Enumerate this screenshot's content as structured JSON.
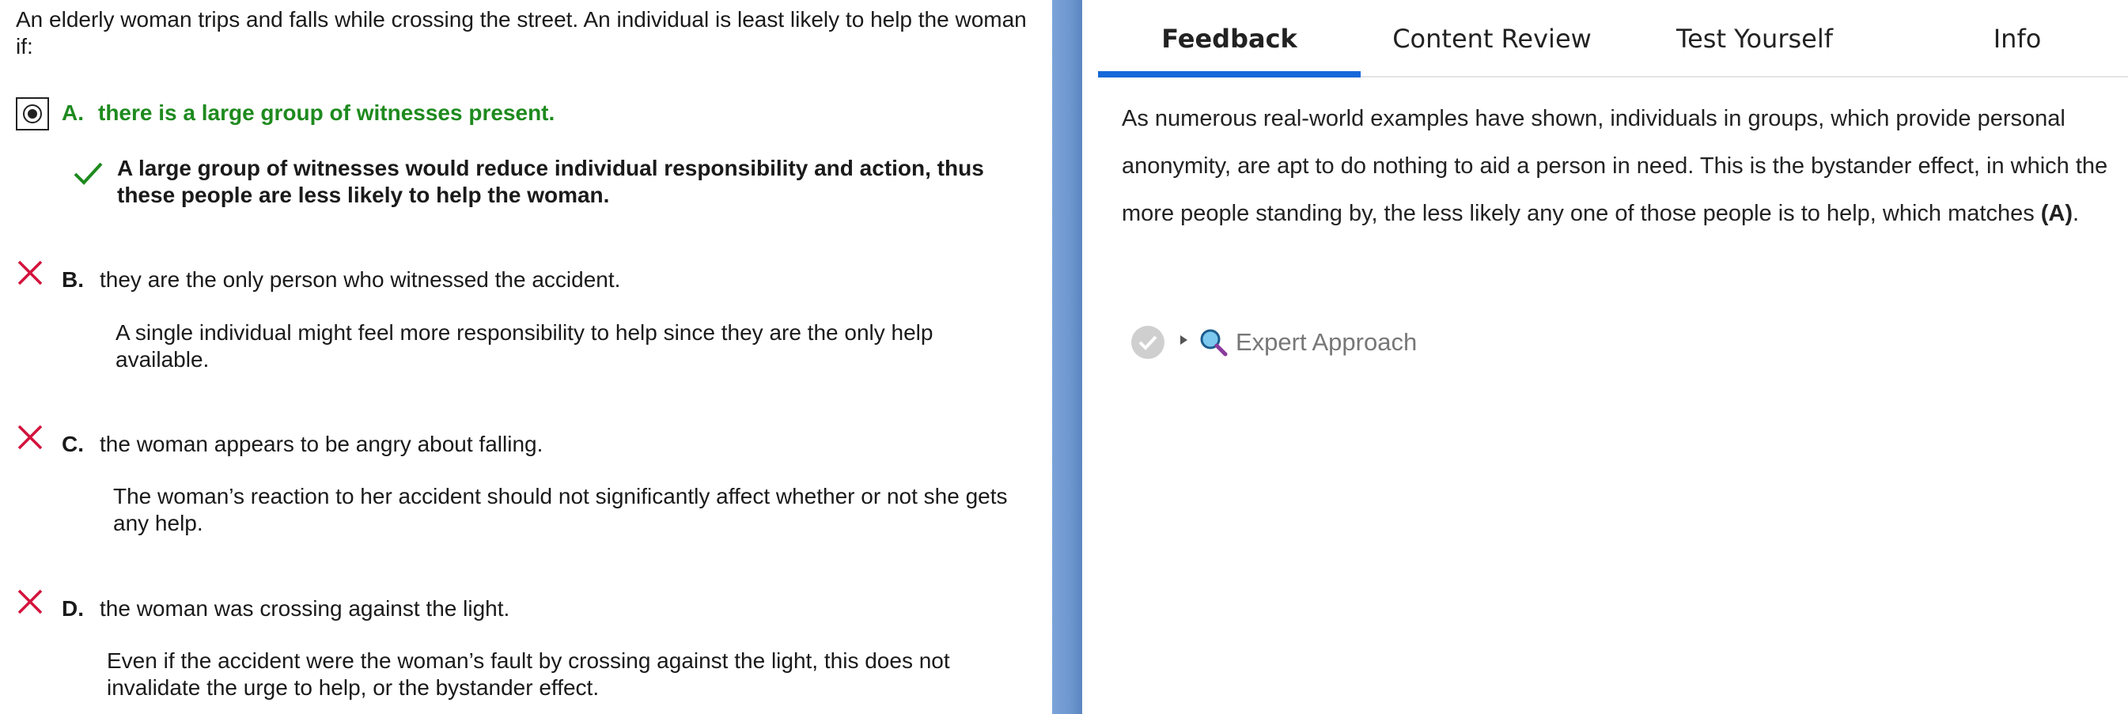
{
  "question": "An elderly woman trips and falls while crossing the street. An individual is least likely to help the woman if:",
  "options": [
    {
      "letter": "A.",
      "text": "there is a large group of witnesses present.",
      "explanation": "A large group of witnesses would reduce individual responsibility and action, thus these people are less likely to help the woman.",
      "status": "correct-selected"
    },
    {
      "letter": "B.",
      "text": "they are the only person who witnessed the accident.",
      "explanation": "A single individual might feel more responsibility to help since they are the only help available.",
      "status": "incorrect"
    },
    {
      "letter": "C.",
      "text": "the woman appears to be angry about falling.",
      "explanation": "The woman’s reaction to her accident should not significantly affect whether or not she gets any help.",
      "status": "incorrect"
    },
    {
      "letter": "D.",
      "text": "the woman was crossing against the light.",
      "explanation": "Even if the accident were the woman’s fault by crossing against the light, this does not invalidate the urge to help, or the bystander effect.",
      "status": "incorrect"
    }
  ],
  "tabs": [
    {
      "label": "Feedback",
      "active": true
    },
    {
      "label": "Content Review",
      "active": false
    },
    {
      "label": "Test Yourself",
      "active": false
    },
    {
      "label": "Info",
      "active": false
    }
  ],
  "feedback": {
    "text": "As numerous real-world examples have shown, individuals in groups, which provide personal anonymity, are apt to do nothing to aid a person in need. This is the bystander effect, in which the more people standing by, the less likely any one of those people is to help, which matches ",
    "answer": "(A)",
    "end": "."
  },
  "expert_approach": {
    "label": "Expert Approach"
  },
  "colors": {
    "correct": "#1e8a1e",
    "incorrect": "#d3123c",
    "tab_accent": "#1668d9",
    "divider": "#6e97cf"
  },
  "icons": {
    "selected": "radio-selected-icon",
    "correct": "checkmark-icon",
    "incorrect": "x-icon",
    "expert_status": "check-circle-icon",
    "expand": "triangle-right-icon",
    "search": "magnifier-icon"
  }
}
